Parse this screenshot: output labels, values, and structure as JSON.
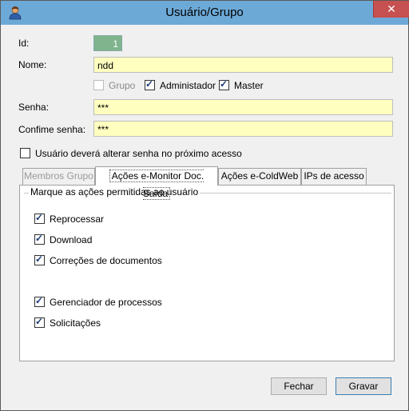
{
  "window": {
    "title": "Usuário/Grupo",
    "close_symbol": "✕"
  },
  "form": {
    "id_label": "Id:",
    "id_value": "1",
    "nome_label": "Nome:",
    "nome_value": "ndd",
    "grupo_label": "Grupo",
    "grupo_checked": false,
    "admin_label": "Administador",
    "admin_checked": true,
    "master_label": "Master",
    "master_checked": true,
    "senha_label": "Senha:",
    "senha_value": "***",
    "confirme_label": "Confime senha:",
    "confirme_value": "***",
    "alterar_label": "Usuário deverá alterar senha no próximo acesso",
    "alterar_checked": false
  },
  "tabs": [
    {
      "label": "Membros Grupo",
      "disabled": true
    },
    {
      "label": "Ações e-Monitor Doc. Saída",
      "active": true
    },
    {
      "label": "Ações e-ColdWeb"
    },
    {
      "label": "IPs de acesso"
    }
  ],
  "panel": {
    "group_title": "Marque as ações permitidas ao usuário",
    "actions": [
      {
        "label": "Reprocessar",
        "checked": true
      },
      {
        "label": "Download",
        "checked": true
      },
      {
        "label": "Correções de documentos",
        "checked": true
      },
      {
        "label": "Gerenciador de processos",
        "checked": true
      },
      {
        "label": "Solicitações",
        "checked": true
      }
    ]
  },
  "buttons": {
    "fechar": "Fechar",
    "gravar": "Gravar"
  },
  "icons": {
    "app": "user-icon"
  }
}
